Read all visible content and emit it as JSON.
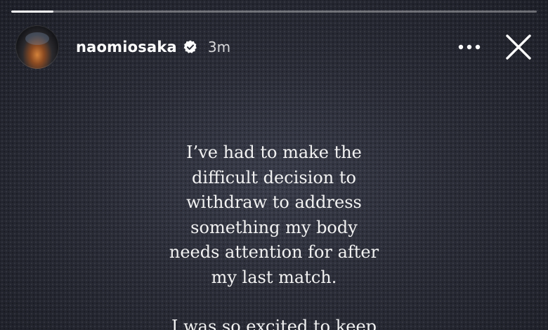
{
  "story": {
    "progress": 0.08,
    "header": {
      "username": "naomiosaka",
      "verified": true,
      "time_ago": "3m",
      "more_icon": "more-horizontal-icon",
      "close_icon": "close-icon"
    },
    "text_lines": [
      "I’ve had to make the",
      "difficult decision to",
      "withdraw to address",
      "something my body",
      "needs attention for after",
      "my last match."
    ],
    "text_partial": "I was so excited to keep"
  }
}
